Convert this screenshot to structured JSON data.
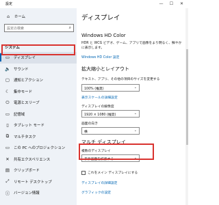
{
  "app_title": "設定",
  "window_controls": {
    "minimize": "—",
    "maximize": "☐",
    "close": "✕"
  },
  "sidebar": {
    "home_label": "ホーム",
    "search_placeholder": "設定の検索",
    "section_label": "システム",
    "items": [
      {
        "label": "ディスプレイ",
        "icon": "▭"
      },
      {
        "label": "サウンド",
        "icon": "🔈"
      },
      {
        "label": "通知とアクション",
        "icon": "▢"
      },
      {
        "label": "集中モード",
        "icon": "☾"
      },
      {
        "label": "電源とスリープ",
        "icon": "⏻"
      },
      {
        "label": "記憶域",
        "icon": "▭"
      },
      {
        "label": "タブレット モード",
        "icon": "▯"
      },
      {
        "label": "マルチタスク",
        "icon": "⧉"
      },
      {
        "label": "この PC へのプロジェクション",
        "icon": "▭"
      },
      {
        "label": "共有エクスペリエンス",
        "icon": "✕"
      },
      {
        "label": "クリップボード",
        "icon": "▤"
      },
      {
        "label": "リモート デスクトップ",
        "icon": "⤢"
      },
      {
        "label": "バージョン情報",
        "icon": "ⓘ"
      }
    ]
  },
  "main": {
    "title": "ディスプレイ",
    "hdr": {
      "heading": "Windows HD Color",
      "description": "HDR と WCG ビデオ、ゲーム、アプリで画像をより明るく、鮮やかに表示します。",
      "link": "Windows HD Color 設定"
    },
    "scale": {
      "heading": "拡大縮小とレイアウト",
      "label": "テキスト、アプリ、その他の項目のサイズを変更する",
      "value": "100% (推奨)",
      "advanced_link": "表示スケールの詳細設定",
      "resolution_label": "ディスプレイの解像度",
      "resolution_value": "1920 × 1080 (推奨)",
      "orientation_label": "画面の向き",
      "orientation_value": "横"
    },
    "multi": {
      "heading": "マルチ ディスプレイ",
      "label": "複数のディスプレイ",
      "value": "表示画面を拡張する",
      "checkbox_label": "これをメイン ディスプレイにする",
      "link1": "ディスプレイの詳細設定",
      "link2": "グラフィックの設定"
    }
  },
  "colors": {
    "highlight": "#d9322e",
    "link": "#0066b4",
    "accent": "#0063b1"
  }
}
